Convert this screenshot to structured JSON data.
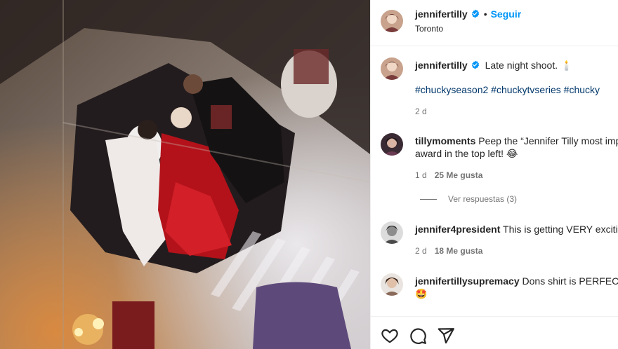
{
  "post": {
    "author": "jennifertilly",
    "verified": true,
    "follow_label": "Seguir",
    "location": "Toronto",
    "caption": "Late night shoot. 🕯️",
    "hashtags": "#chuckyseason2 #chuckytvseries #chucky",
    "age": "2 d"
  },
  "comments": [
    {
      "user": "tillymoments",
      "text_line1": "Peep the “Jennifer Tilly most imp",
      "text_line2": "award in the top left! 😂",
      "age": "1 d",
      "likes": "25 Me gusta",
      "replies": "Ver respuestas (3)"
    },
    {
      "user": "jennifer4president",
      "text_line1": "This is getting VERY excitin",
      "age": "2 d",
      "likes": "18 Me gusta"
    },
    {
      "user": "jennifertillysupremacy",
      "text_line1": "Dons shirt is PERFECT fo",
      "text_line2": "🤩"
    }
  ],
  "colors": {
    "link_blue": "#0095f6",
    "hashtag": "#00376b",
    "verified_badge": "#0095f6",
    "muted_text": "#737373"
  },
  "icons": {
    "like": "heart-icon",
    "comment": "comment-icon",
    "share": "paper-plane-icon",
    "verified": "verified-badge-icon"
  }
}
